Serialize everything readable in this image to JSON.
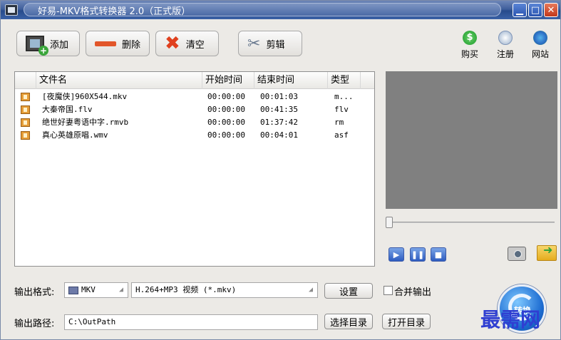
{
  "window": {
    "title": "好易-MKV格式转换器 2.0（正式版）",
    "minimize": "▁",
    "maximize": "□",
    "close": "✕"
  },
  "toolbar": {
    "add_label": "添加",
    "delete_label": "删除",
    "clear_label": "清空",
    "cut_label": "剪辑"
  },
  "tools_right": {
    "buy_label": "购买",
    "register_label": "注册",
    "website_label": "网站"
  },
  "filelist": {
    "headers": [
      "文件名",
      "开始时间",
      "结束时间",
      "类型"
    ],
    "rows": [
      {
        "name": "[夜魔侠]960X544.mkv",
        "start": "00:00:00",
        "end": "00:01:03",
        "type": "m..."
      },
      {
        "name": "大秦帝国.flv",
        "start": "00:00:00",
        "end": "00:41:35",
        "type": "flv"
      },
      {
        "name": "绝世好妻粤语中字.rmvb",
        "start": "00:00:00",
        "end": "01:37:42",
        "type": "rm"
      },
      {
        "name": "真心英雄原唱.wmv",
        "start": "00:00:00",
        "end": "00:04:01",
        "type": "asf"
      }
    ]
  },
  "player": {
    "play": "▶",
    "pause": "❚❚",
    "stop": "■",
    "seek_fraction": 0
  },
  "output": {
    "format_label": "输出格式:",
    "format_value": "MKV",
    "preset_value": "H.264+MP3 视频 (*.mkv)",
    "settings_label": "设置",
    "merge_label": "合并输出",
    "path_label": "输出路径:",
    "path_value": "C:\\OutPath",
    "choose_dir_label": "选择目录",
    "open_dir_label": "打开目录"
  },
  "convert": {
    "label": "转换"
  },
  "watermark": "最需网",
  "colors": {
    "titlebar": "#274b8c",
    "preview_bg": "#808080",
    "accent": "#1b6ad0"
  }
}
